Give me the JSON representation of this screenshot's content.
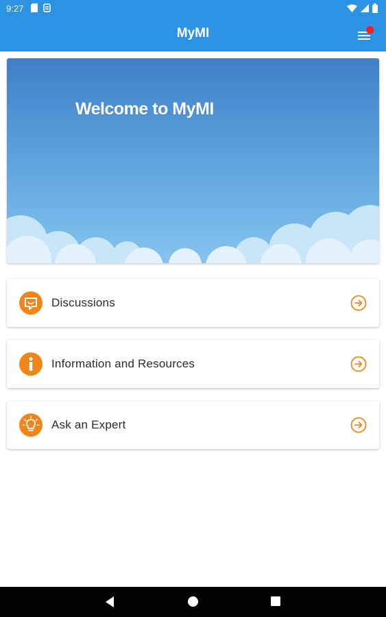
{
  "status_bar": {
    "time": "9:27"
  },
  "app_bar": {
    "title": "MyMI"
  },
  "hero": {
    "title": "Welcome to MyMI"
  },
  "cards": [
    {
      "label": "Discussions",
      "icon": "chat-bubble-icon"
    },
    {
      "label": "Information and Resources",
      "icon": "info-icon"
    },
    {
      "label": "Ask an Expert",
      "icon": "lightbulb-icon"
    }
  ],
  "colors": {
    "primary": "#2a93e4",
    "accent": "#f0861a",
    "notification": "#ff1a1a"
  }
}
